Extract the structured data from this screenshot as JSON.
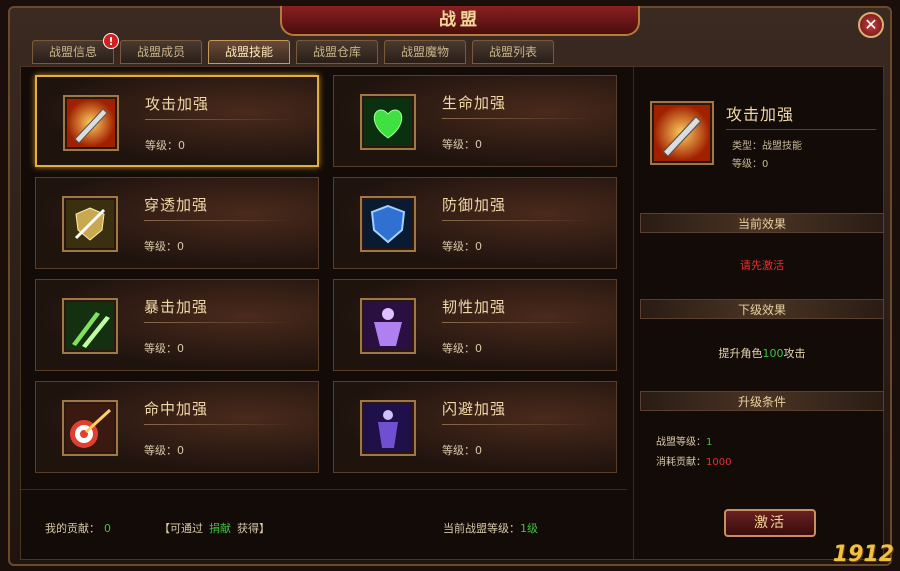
{
  "window": {
    "title": "战盟",
    "close_label": "✕"
  },
  "tabs": [
    {
      "label": "战盟信息",
      "badge": "!"
    },
    {
      "label": "战盟成员"
    },
    {
      "label": "战盟技能"
    },
    {
      "label": "战盟仓库"
    },
    {
      "label": "战盟魔物"
    },
    {
      "label": "战盟列表"
    }
  ],
  "skills": [
    {
      "name": "攻击加强",
      "level": "等级：0",
      "icon": "flaming-sword-icon",
      "color": "#e06020"
    },
    {
      "name": "生命加强",
      "level": "等级：0",
      "icon": "green-heart-icon",
      "color": "#40d040"
    },
    {
      "name": "穿透加强",
      "level": "等级：0",
      "icon": "pierced-shield-icon",
      "color": "#e0c060"
    },
    {
      "name": "防御加强",
      "level": "等级：0",
      "icon": "blue-shield-icon",
      "color": "#4080e0"
    },
    {
      "name": "暴击加强",
      "level": "等级：0",
      "icon": "green-blades-icon",
      "color": "#60c040"
    },
    {
      "name": "韧性加强",
      "level": "等级：0",
      "icon": "purple-body-icon",
      "color": "#a060e0"
    },
    {
      "name": "命中加强",
      "level": "等级：0",
      "icon": "target-icon",
      "color": "#e04030"
    },
    {
      "name": "闪避加强",
      "level": "等级：0",
      "icon": "dodge-figure-icon",
      "color": "#8060e0"
    }
  ],
  "bottom": {
    "contrib_label": "我的贡献：",
    "contrib_value": "0",
    "howto_prefix": "【可通过",
    "howto_link": "捐献",
    "howto_suffix": "获得】",
    "guild_level_label": "当前战盟等级：",
    "guild_level_value": "1级"
  },
  "detail": {
    "name": "攻击加强",
    "type": "类型：战盟技能",
    "level": "等级：0",
    "current_effect_head": "当前效果",
    "current_effect": "请先激活",
    "next_effect_head": "下级效果",
    "next_effect_prefix": "提升角色",
    "next_effect_value": "100",
    "next_effect_suffix": "攻击",
    "upgrade_head": "升级条件",
    "cond_guild_label": "战盟等级：",
    "cond_guild_value": "1",
    "cond_cost_label": "消耗贡献：",
    "cond_cost_value": "1000",
    "activate_label": "激活"
  },
  "logo": "1912"
}
